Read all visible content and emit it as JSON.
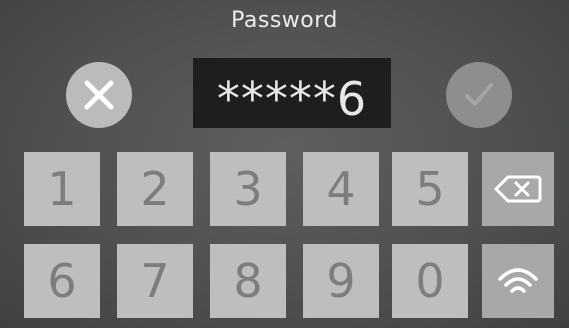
{
  "header": {
    "title": "Password"
  },
  "password_field": {
    "value": "*****6"
  },
  "keypad": {
    "row1": [
      "1",
      "2",
      "3",
      "4",
      "5"
    ],
    "row2": [
      "6",
      "7",
      "8",
      "9",
      "0"
    ]
  },
  "icons": {
    "cancel": "close-icon",
    "confirm": "checkmark-icon",
    "backspace": "backspace-icon",
    "wifi": "wifi-icon"
  },
  "colors": {
    "background": "#4e5150",
    "key": "#bcbfbe",
    "key_text": "#7b7e7d",
    "field": "#1d1f1f"
  }
}
